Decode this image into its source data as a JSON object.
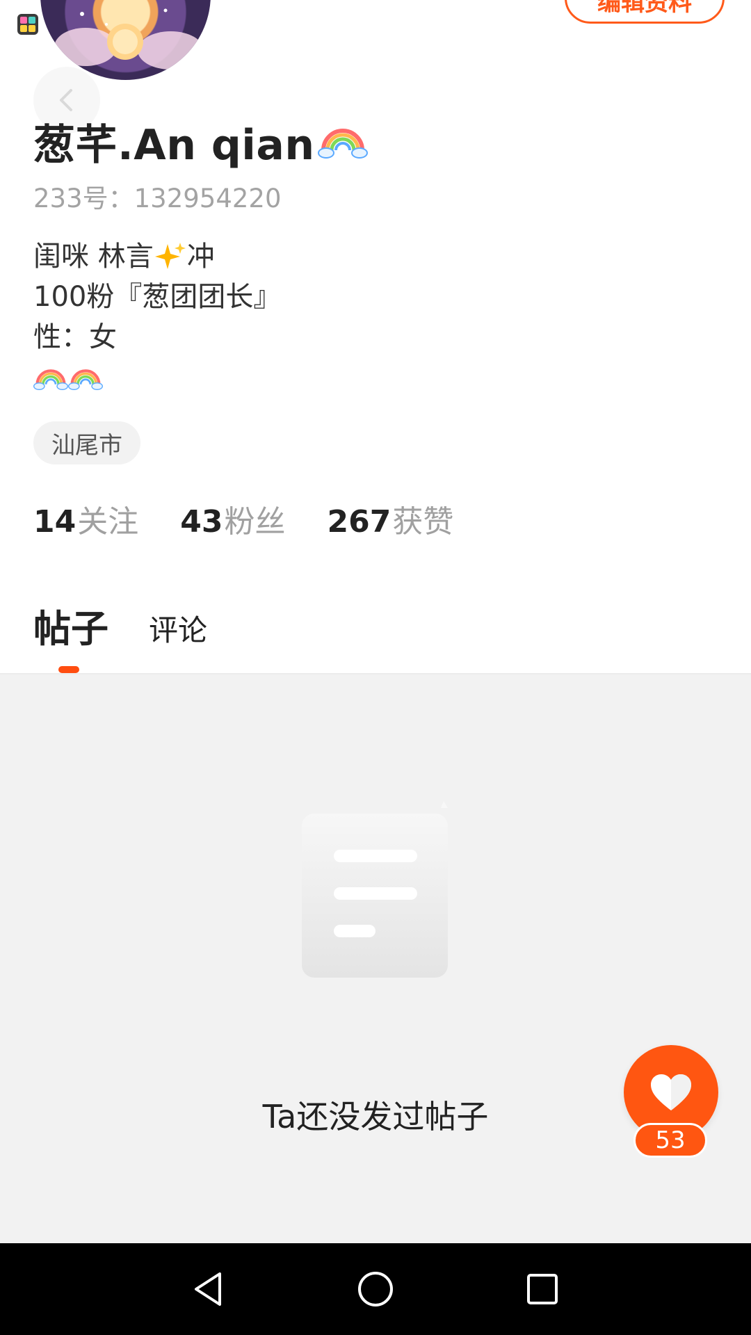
{
  "header": {
    "edit_label": "编辑资料"
  },
  "profile": {
    "name": "葱芊.An qian",
    "uid": "233号：132954220",
    "bio": {
      "line1_a": "闺咪 林言",
      "line1_b": "冲",
      "line2": "100粉『葱团团长』",
      "line3": "性：女"
    },
    "location": "汕尾市"
  },
  "stats": [
    {
      "num": "14",
      "label": "关注"
    },
    {
      "num": "43",
      "label": "粉丝"
    },
    {
      "num": "267",
      "label": "获赞"
    }
  ],
  "tabs": {
    "posts": "帖子",
    "comments": "评论"
  },
  "content": {
    "empty_text": "Ta还没发过帖子"
  },
  "fab": {
    "count": "53"
  },
  "colors": {
    "accent": "#ff5611",
    "text_primary": "#222222",
    "text_secondary": "#a3a3a3",
    "content_bg": "#f2f2f2"
  },
  "icons": {
    "back": "back-arrow-icon",
    "heart": "heart-icon",
    "rainbow": "rainbow-emoji-icon",
    "sparkle": "sparkle-emoji-icon",
    "nav_back": "triangle-back-icon",
    "nav_home": "circle-home-icon",
    "nav_recents": "square-recents-icon"
  }
}
